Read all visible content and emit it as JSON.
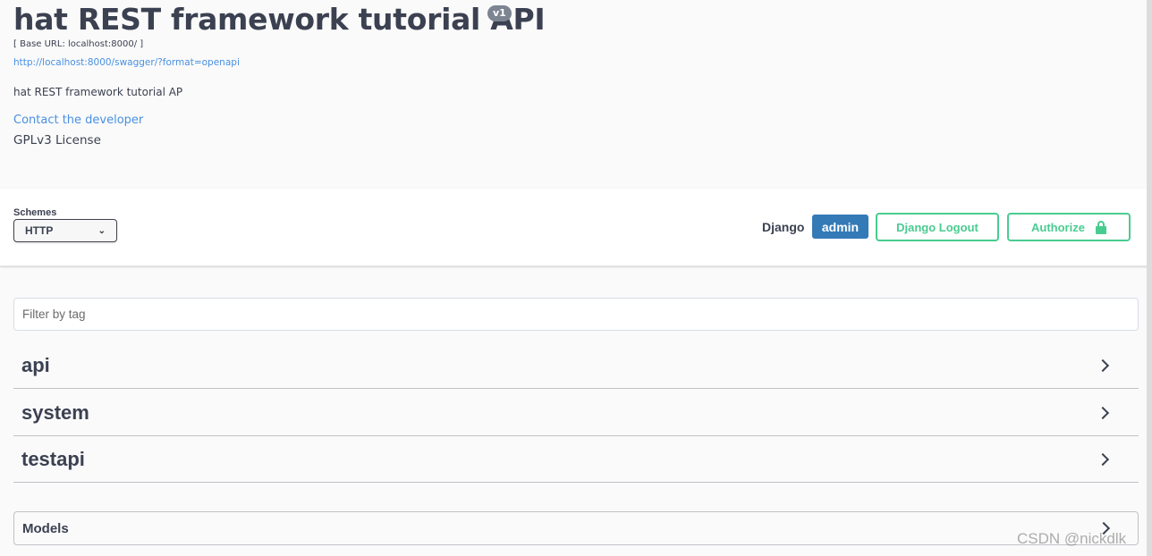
{
  "info": {
    "title": "hat REST framework tutorial API",
    "version": "v1",
    "base_url": "[ Base URL: localhost:8000/ ]",
    "spec_url": "http://localhost:8000/swagger/?format=openapi",
    "description": "hat REST framework tutorial AP",
    "contact": "Contact the developer",
    "license": "GPLv3 License"
  },
  "scheme_bar": {
    "label": "Schemes",
    "selected": "HTTP",
    "auth_user_label": "Django",
    "user_badge": "admin",
    "logout_label": "Django Logout",
    "authorize_label": "Authorize"
  },
  "filter": {
    "placeholder": "Filter by tag"
  },
  "tags": [
    {
      "name": "api"
    },
    {
      "name": "system"
    },
    {
      "name": "testapi"
    }
  ],
  "models": {
    "title": "Models"
  },
  "watermark": "CSDN @nickdlk",
  "colors": {
    "accent_green": "#49cc90",
    "badge_blue": "#337ab7",
    "link_blue": "#4990e2",
    "text_dark": "#3b4151"
  }
}
